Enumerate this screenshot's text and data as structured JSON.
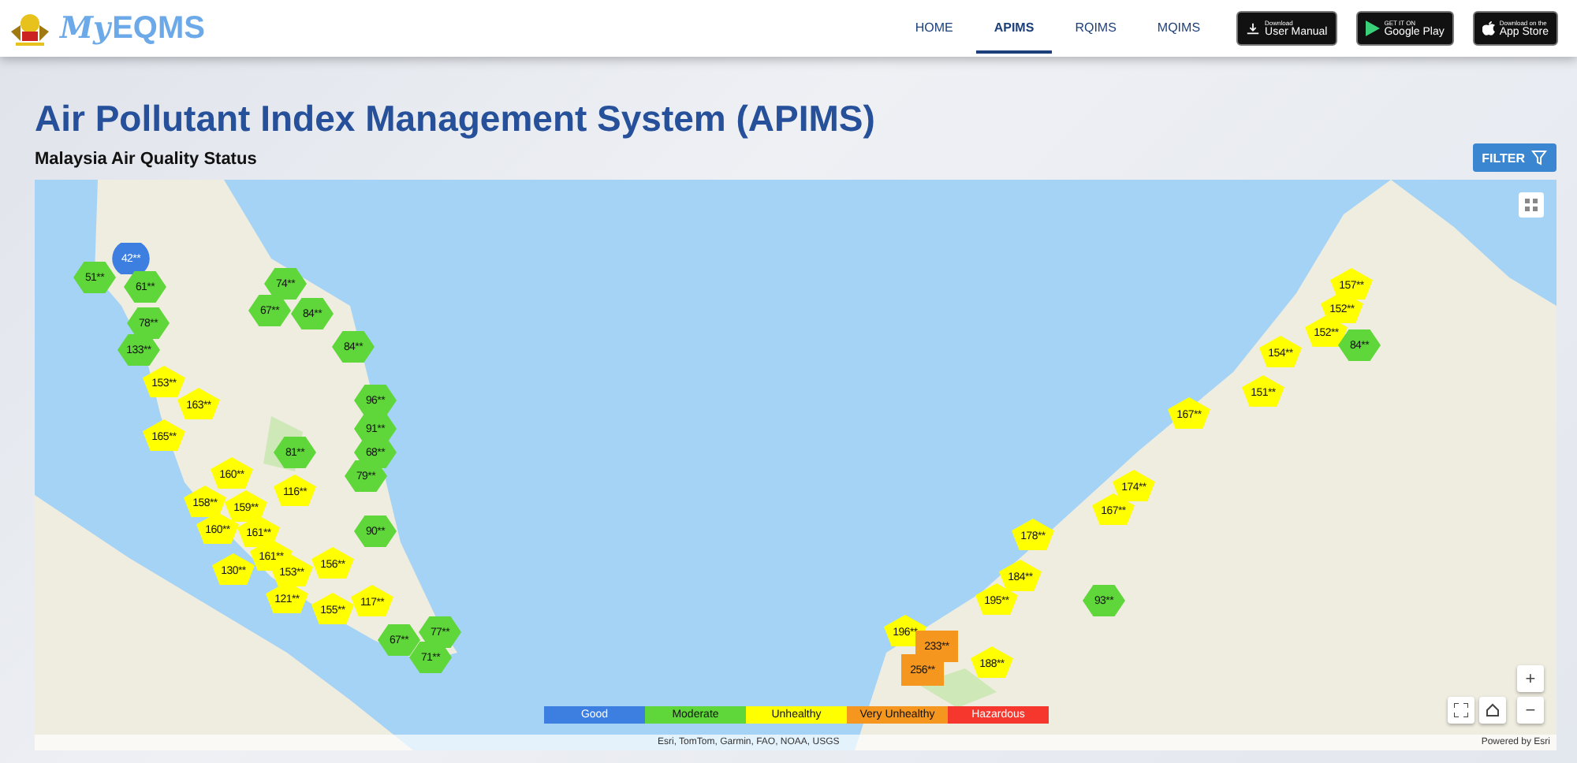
{
  "header": {
    "logo": {
      "script": "My",
      "main": "EQMS"
    },
    "nav": [
      {
        "label": "HOME",
        "selected": false
      },
      {
        "label": "APIMS",
        "selected": true
      },
      {
        "label": "RQIMS",
        "selected": false
      },
      {
        "label": "MQIMS",
        "selected": false
      }
    ],
    "downloads": [
      {
        "kind": "manual",
        "small": "Download",
        "big": "User Manual"
      },
      {
        "kind": "play",
        "small": "GET IT ON",
        "big": "Google Play"
      },
      {
        "kind": "apple",
        "small": "Download on the",
        "big": "App Store"
      }
    ]
  },
  "title": "Air Pollutant Index Management System (APIMS)",
  "subtitle": "Malaysia Air Quality Status",
  "filter_button": "FILTER",
  "map": {
    "markers": [
      {
        "value": "42**",
        "kind": "circle",
        "color": "#3d7fe0"
      },
      {
        "value": "51**",
        "kind": "hexagon",
        "color": "#5fd63a"
      },
      {
        "value": "61**",
        "kind": "hexagon",
        "color": "#5fd63a"
      },
      {
        "value": "74**",
        "kind": "hexagon",
        "color": "#5fd63a"
      },
      {
        "value": "67**",
        "kind": "hexagon",
        "color": "#5fd63a"
      },
      {
        "value": "84**",
        "kind": "hexagon",
        "color": "#5fd63a"
      },
      {
        "value": "78**",
        "kind": "hexagon",
        "color": "#5fd63a"
      },
      {
        "value": "133**",
        "kind": "hexagon",
        "color": "#5fd63a"
      },
      {
        "value": "84**",
        "kind": "hexagon",
        "color": "#5fd63a"
      },
      {
        "value": "153**",
        "kind": "pentagon",
        "color": "#ffff00"
      },
      {
        "value": "163**",
        "kind": "pentagon",
        "color": "#ffff00"
      },
      {
        "value": "165**",
        "kind": "pentagon",
        "color": "#ffff00"
      },
      {
        "value": "96**",
        "kind": "hexagon",
        "color": "#5fd63a"
      },
      {
        "value": "91**",
        "kind": "hexagon",
        "color": "#5fd63a"
      },
      {
        "value": "68**",
        "kind": "hexagon",
        "color": "#5fd63a"
      },
      {
        "value": "79**",
        "kind": "hexagon",
        "color": "#5fd63a"
      },
      {
        "value": "81**",
        "kind": "hexagon",
        "color": "#5fd63a"
      },
      {
        "value": "160**",
        "kind": "pentagon",
        "color": "#ffff00"
      },
      {
        "value": "116**",
        "kind": "pentagon",
        "color": "#ffff00"
      },
      {
        "value": "158**",
        "kind": "pentagon",
        "color": "#ffff00"
      },
      {
        "value": "159**",
        "kind": "pentagon",
        "color": "#ffff00"
      },
      {
        "value": "160**",
        "kind": "pentagon",
        "color": "#ffff00"
      },
      {
        "value": "161**",
        "kind": "pentagon",
        "color": "#ffff00"
      },
      {
        "value": "161**",
        "kind": "pentagon",
        "color": "#ffff00"
      },
      {
        "value": "90**",
        "kind": "hexagon",
        "color": "#5fd63a"
      },
      {
        "value": "130**",
        "kind": "pentagon",
        "color": "#ffff00"
      },
      {
        "value": "153**",
        "kind": "pentagon",
        "color": "#ffff00"
      },
      {
        "value": "121**",
        "kind": "pentagon",
        "color": "#ffff00"
      },
      {
        "value": "156**",
        "kind": "pentagon",
        "color": "#ffff00"
      },
      {
        "value": "155**",
        "kind": "pentagon",
        "color": "#ffff00"
      },
      {
        "value": "117**",
        "kind": "pentagon",
        "color": "#ffff00"
      },
      {
        "value": "67**",
        "kind": "hexagon",
        "color": "#5fd63a"
      },
      {
        "value": "77**",
        "kind": "hexagon",
        "color": "#5fd63a"
      },
      {
        "value": "71**",
        "kind": "hexagon",
        "color": "#5fd63a"
      },
      {
        "value": "157**",
        "kind": "pentagon",
        "color": "#ffff00"
      },
      {
        "value": "152**",
        "kind": "pentagon",
        "color": "#ffff00"
      },
      {
        "value": "152**",
        "kind": "pentagon",
        "color": "#ffff00"
      },
      {
        "value": "154**",
        "kind": "pentagon",
        "color": "#ffff00"
      },
      {
        "value": "84**",
        "kind": "hexagon",
        "color": "#5fd63a"
      },
      {
        "value": "151**",
        "kind": "pentagon",
        "color": "#ffff00"
      },
      {
        "value": "167**",
        "kind": "pentagon",
        "color": "#ffff00"
      },
      {
        "value": "174**",
        "kind": "pentagon",
        "color": "#ffff00"
      },
      {
        "value": "167**",
        "kind": "pentagon",
        "color": "#ffff00"
      },
      {
        "value": "178**",
        "kind": "pentagon",
        "color": "#ffff00"
      },
      {
        "value": "184**",
        "kind": "pentagon",
        "color": "#ffff00"
      },
      {
        "value": "195**",
        "kind": "pentagon",
        "color": "#ffff00"
      },
      {
        "value": "93**",
        "kind": "hexagon",
        "color": "#5fd63a"
      },
      {
        "value": "196**",
        "kind": "pentagon",
        "color": "#ffff00"
      },
      {
        "value": "233**",
        "kind": "square",
        "color": "#f5961e"
      },
      {
        "value": "256**",
        "kind": "square",
        "color": "#f5961e"
      },
      {
        "value": "188**",
        "kind": "pentagon",
        "color": "#ffff00"
      }
    ],
    "legend": [
      {
        "label": "Good",
        "color": "#3d7fe0"
      },
      {
        "label": "Moderate",
        "color": "#5fd63a"
      },
      {
        "label": "Unhealthy",
        "color": "#ffff00"
      },
      {
        "label": "Very Unhealthy",
        "color": "#f5961e"
      },
      {
        "label": "Hazardous",
        "color": "#f5372d"
      }
    ],
    "zoom_in": "+",
    "zoom_out": "−",
    "attribution": "Esri, TomTom, Garmin, FAO, NOAA, USGS",
    "powered_by": "Powered by Esri"
  }
}
